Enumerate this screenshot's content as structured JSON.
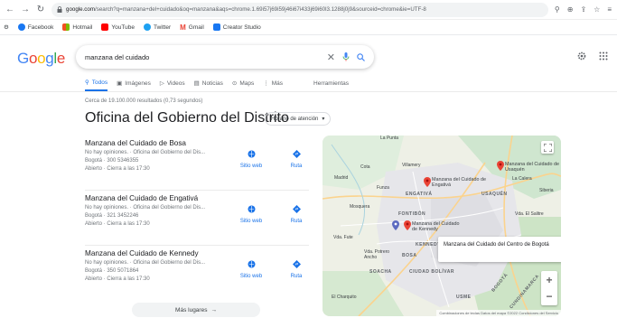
{
  "browser": {
    "url_host": "google.com",
    "url_rest": "/search?q=manzana+del+cuidado&oq=manzana&aqs=chrome.1.69i57j69i59j46i67i433j69i60l3.1288j0j9&sourceid=chrome&ie=UTF-8"
  },
  "bookmarks": [
    {
      "label": "Facebook",
      "color": "#1877f2"
    },
    {
      "label": "Hotmail",
      "color": "#f25022"
    },
    {
      "label": "YouTube",
      "color": "#ff0000"
    },
    {
      "label": "Twitter",
      "color": "#1da1f2"
    },
    {
      "label": "Gmail",
      "color": "#ea4335"
    },
    {
      "label": "Creator Studio",
      "color": "#1877f2"
    }
  ],
  "header": {
    "logo": "Google",
    "query": "manzana del cuidado"
  },
  "tabs": [
    {
      "label": "Todos",
      "icon": "search-icon",
      "active": true
    },
    {
      "label": "Imágenes",
      "icon": "image-icon"
    },
    {
      "label": "Videos",
      "icon": "video-icon"
    },
    {
      "label": "Noticias",
      "icon": "news-icon"
    },
    {
      "label": "Maps",
      "icon": "map-pin-icon"
    },
    {
      "label": "Más",
      "icon": "more-vert-icon"
    }
  ],
  "tools_label": "Herramientas",
  "stats": "Cerca de 19.100.000 resultados (0,73 segundos)",
  "knowledge_panel": {
    "title": "Oficina del Gobierno del Distrito",
    "hours_chip": "Horario de atención"
  },
  "places": [
    {
      "name": "Manzana del Cuidado de Bosa",
      "rating": "No hay opiniones. · Oficina del Gobierno del Dis...",
      "address": "Bogotá · 300 5346355",
      "status": "Abierto · Cierra a las 17:30"
    },
    {
      "name": "Manzana del Cuidado de Engativá",
      "rating": "No hay opiniones. · Oficina del Gobierno del Dis...",
      "address": "Bogotá · 321 3452246",
      "status": "Abierto · Cierra a las 17:30"
    },
    {
      "name": "Manzana del Cuidado de Kennedy",
      "rating": "No hay opiniones. · Oficina del Gobierno del Dis...",
      "address": "Bogotá · 350 5071864",
      "status": "Abierto · Cierra a las 17:30"
    }
  ],
  "place_buttons": {
    "website": "Sitio web",
    "route": "Ruta"
  },
  "more_places": "Más lugares",
  "map": {
    "labels": [
      "La Punta",
      "Cota",
      "Villamery",
      "Madrid",
      "Funza",
      "Mosquera",
      "ENGATIVÁ",
      "USAQUÉN",
      "FONTIBÓN",
      "La Calera",
      "Siberia",
      "Vda. El Salitre",
      "Vda. Fute",
      "KENNEDY",
      "BOSA",
      "Vda. Potrero Ancho",
      "CIUDAD BOLÍVAR",
      "SOACHA",
      "El Charquito",
      "USME",
      "BOGOTÁ",
      "CUNDINAMARCA"
    ],
    "pins": [
      {
        "label": "Manzana del Cuidado de Usaquén"
      },
      {
        "label": "Manzana del Cuidado de Engativá"
      },
      {
        "label": "Manzana del Cuidado de Kennedy"
      }
    ],
    "tooltip": "Manzana del Cuidado del Centro de Bogotá",
    "attribution": "Combinaciones de teclas   Datos del mapa ©2022   Condiciones del Servicio"
  }
}
